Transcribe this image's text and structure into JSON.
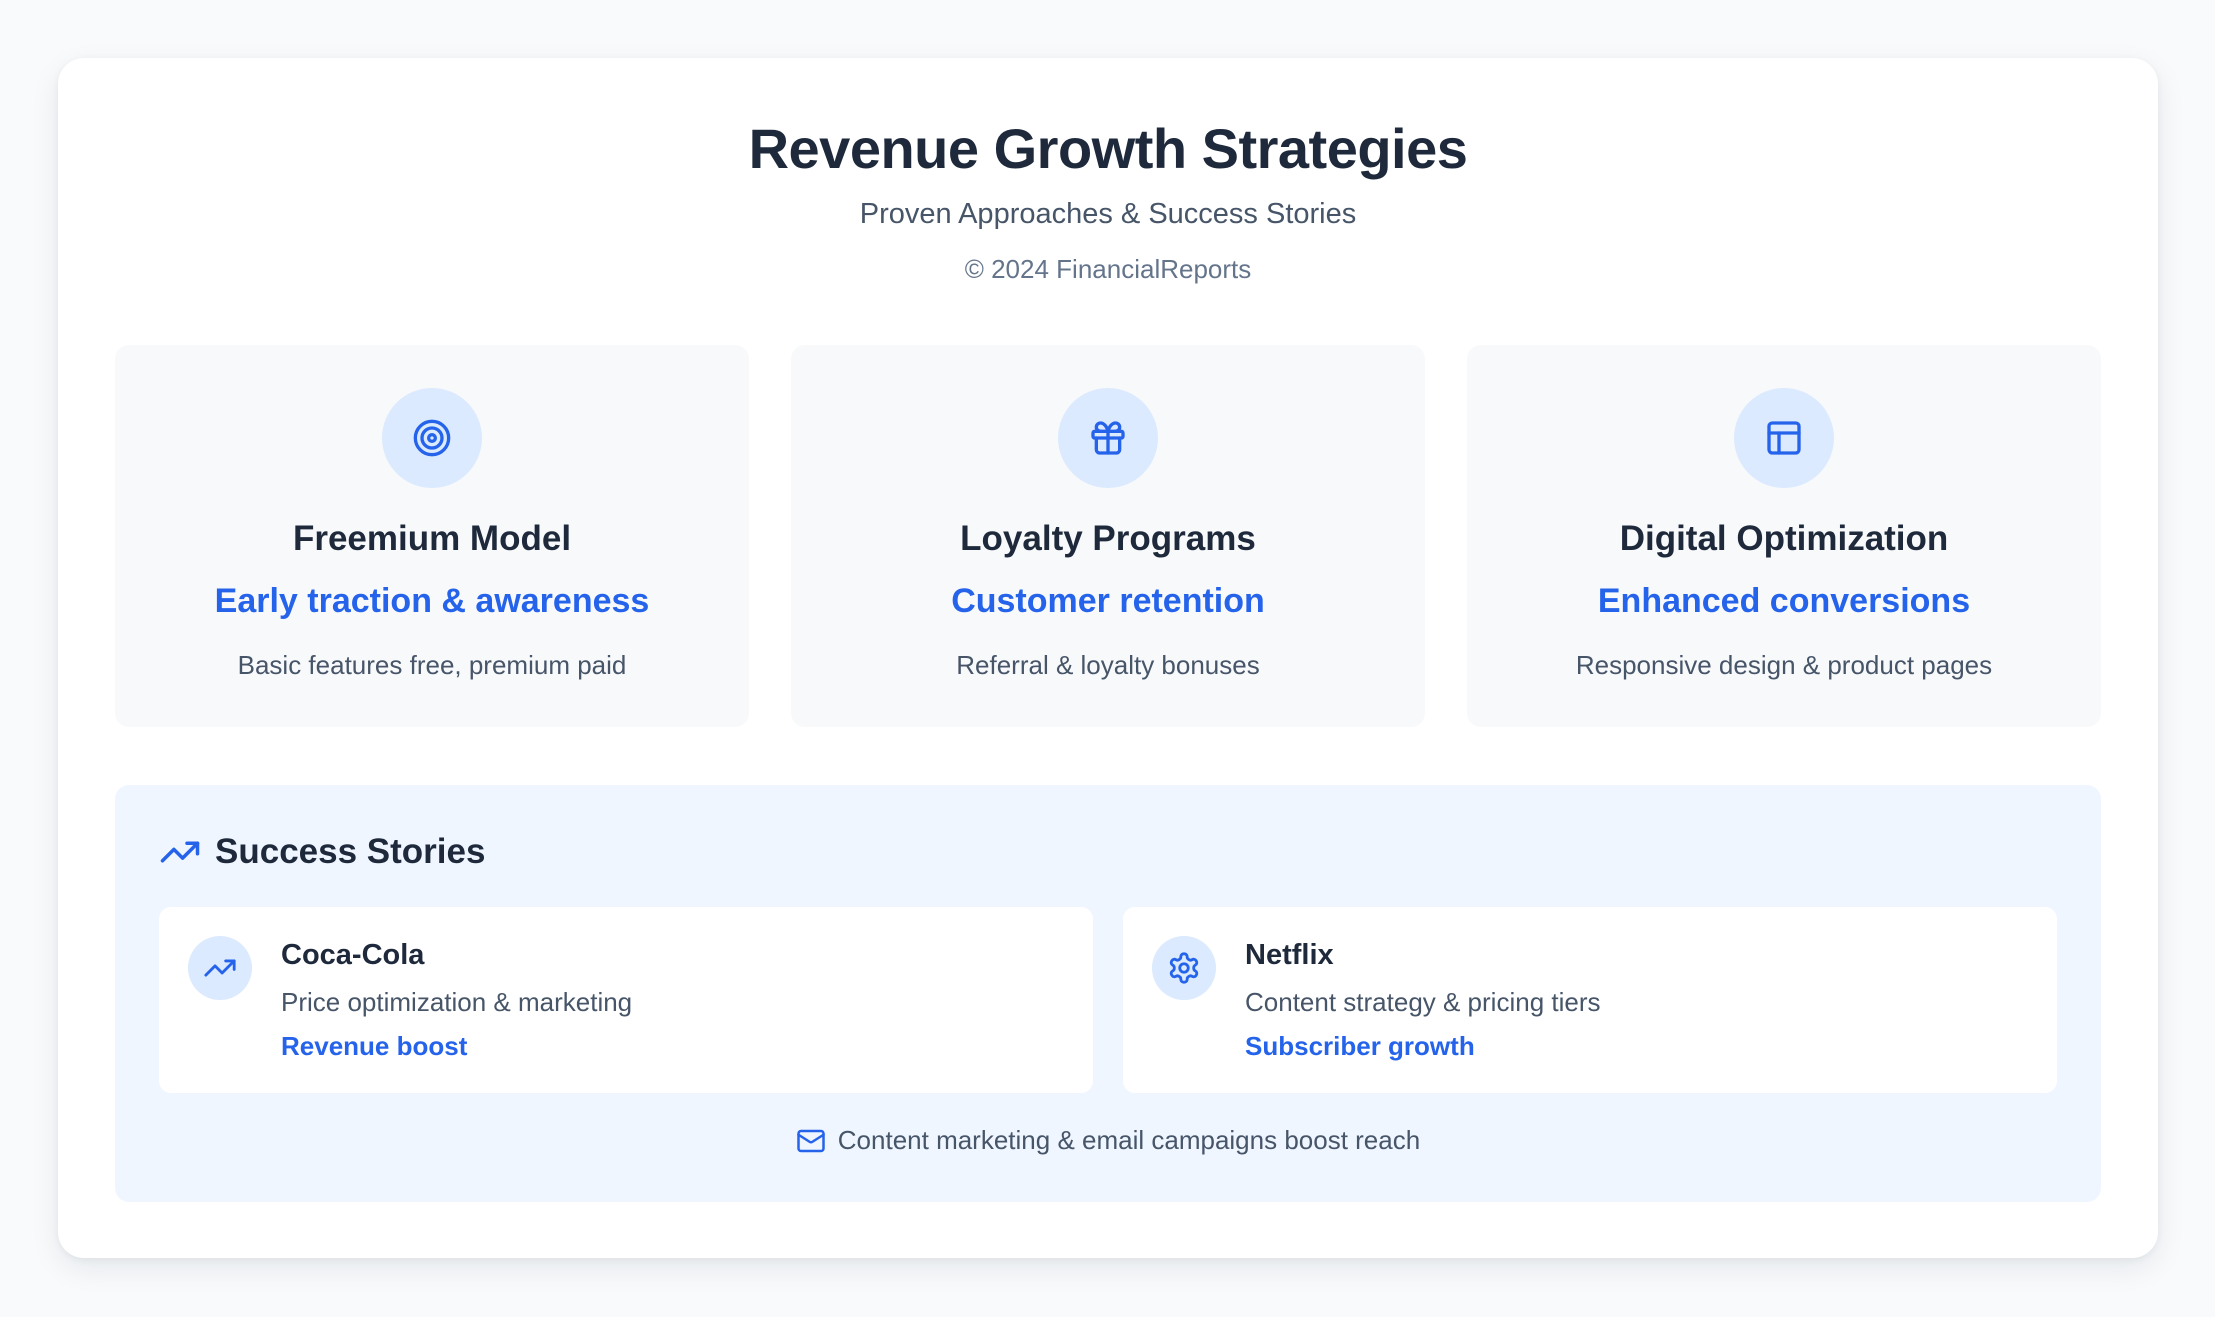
{
  "header": {
    "title": "Revenue Growth Strategies",
    "subtitle": "Proven Approaches & Success Stories",
    "copyright": "© 2024 FinancialReports"
  },
  "strategies": [
    {
      "icon": "target-icon",
      "title": "Freemium Model",
      "tagline": "Early traction & awareness",
      "description": "Basic features free, premium paid"
    },
    {
      "icon": "gift-icon",
      "title": "Loyalty Programs",
      "tagline": "Customer retention",
      "description": "Referral & loyalty bonuses"
    },
    {
      "icon": "layout-icon",
      "title": "Digital Optimization",
      "tagline": "Enhanced conversions",
      "description": "Responsive design & product pages"
    }
  ],
  "success": {
    "icon": "trending-up-icon",
    "title": "Success Stories",
    "stories": [
      {
        "icon": "trending-up-icon",
        "name": "Coca-Cola",
        "description": "Price optimization & marketing",
        "result": "Revenue boost"
      },
      {
        "icon": "gear-icon",
        "name": "Netflix",
        "description": "Content strategy & pricing tiers",
        "result": "Subscriber growth"
      }
    ],
    "footnote_icon": "mail-icon",
    "footnote": "Content marketing & email campaigns boost reach"
  },
  "colors": {
    "accent": "#2563eb",
    "icon_bg": "#dbeafe",
    "heading": "#1e293b",
    "body_text": "#475569",
    "success_bg": "#eff6ff",
    "card_bg": "#f8f9fb"
  }
}
